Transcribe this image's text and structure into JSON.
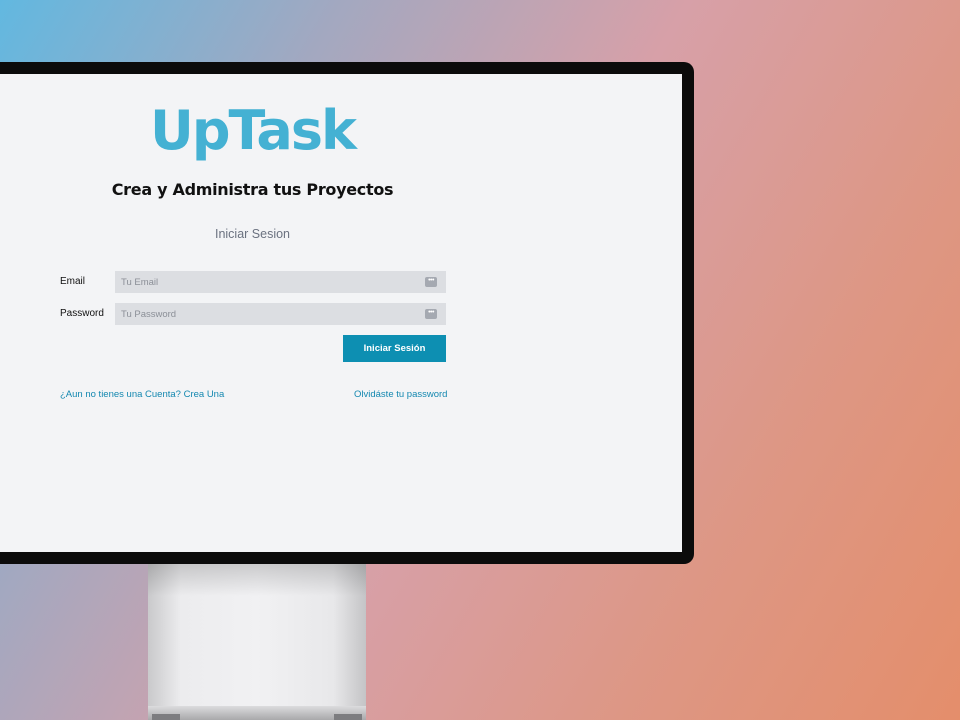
{
  "app": {
    "logo": "UpTask",
    "tagline": "Crea y Administra tus Proyectos"
  },
  "page": {
    "title": "Iniciar Sesion"
  },
  "form": {
    "email": {
      "label": "Email",
      "placeholder": "Tu Email",
      "value": ""
    },
    "password": {
      "label": "Password",
      "placeholder": "Tu Password",
      "value": ""
    },
    "submit_label": "Iniciar Sesión",
    "field_icon": "password-manager-icon"
  },
  "links": {
    "register": "¿Aun no tienes una Cuenta? Crea Una",
    "forgot": "Olvidáste tu password"
  },
  "colors": {
    "brand": "#44b1d3",
    "button": "#0d8fb2",
    "link": "#1488b0",
    "screen_bg": "#f3f4f6",
    "input_bg": "#dcdee2"
  }
}
